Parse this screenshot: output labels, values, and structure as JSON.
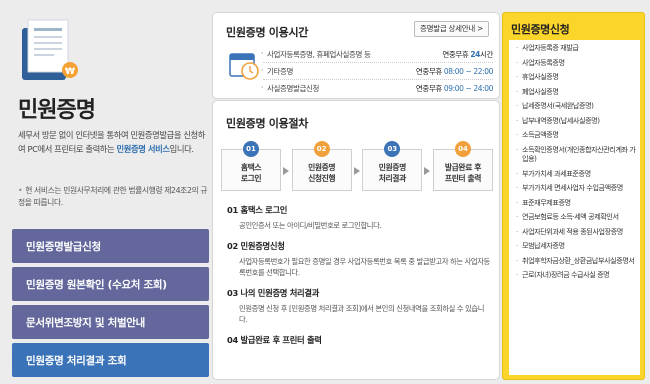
{
  "left": {
    "title": "민원증명",
    "desc_part1": "세무서 방문 없이 인터넷을 통하여 민원증명발급을 신청하여 PC에서 프린터로 출력하는 ",
    "desc_highlight": "민원증명 서비스",
    "desc_part2": "입니다.",
    "note": "현 서비스는 민원사무처리에 관한 법률시행령 제24조2의 규정을 따릅니다.",
    "menu": [
      "민원증명발급신청",
      "민원증명 원본확인 (수요처 조회)",
      "문서위변조방지 및 처벌안내",
      "민원증명 처리결과 조회"
    ]
  },
  "hours": {
    "title": "민원증명 이용시간",
    "detail_button": "증명발급 상세안내 >",
    "rows": [
      {
        "label": "사업자등록증명, 휴폐업사실증명 등",
        "val_prefix": "연중무휴 ",
        "val_time": "24",
        "val_suffix": "시간"
      },
      {
        "label": "기타증명",
        "val_prefix": "연중무휴 ",
        "val_time": "08:00 ~ 22:00",
        "val_suffix": ""
      },
      {
        "label": "사실증명발급신청",
        "val_prefix": "연중무휴 ",
        "val_time": "09:00 ~ 24:00",
        "val_suffix": ""
      }
    ]
  },
  "procedure": {
    "title": "민원증명 이용절차",
    "steps": [
      {
        "num": "01",
        "label": "홈택스\n로그인",
        "color": "#3b73b8"
      },
      {
        "num": "02",
        "label": "민원증명\n신청진행",
        "color": "#f0a13c"
      },
      {
        "num": "03",
        "label": "민원증명\n처리결과",
        "color": "#3b73b8"
      },
      {
        "num": "04",
        "label": "발급완료 후\n프린터 출력",
        "color": "#f0a13c"
      }
    ],
    "items": [
      {
        "head": "01 홈택스 로그인",
        "body": "공인인증서 또는 아이디/비밀번호로 로그인합니다."
      },
      {
        "head": "02 민원증명신청",
        "body": "사업자등록번호가 필요한 증명일 경우 사업자등록번호 목록 중 발급받고자 하는 사업자등록번호를 선택합니다."
      },
      {
        "head": "03 나의 민원증명 처리결과",
        "body": "민원증명 신청 후 [민원증명 처리결과 조회]에서 본인의 신청내역을 조회하실 수 있습니다."
      },
      {
        "head": "04 발급완료 후 프린터 출력",
        "body": ""
      }
    ]
  },
  "application": {
    "title": "민원증명신청",
    "items": [
      "사업자등록증 재발급",
      "사업자등록증명",
      "휴업사실증명",
      "폐업사실증명",
      "납세증명서(국세완납증명)",
      "납부내역증명(납세사실증명)",
      "소득금액증명",
      "소득확인증명서(개인종합자산관리계좌 가입용)",
      "부가가치세 과세표준증명",
      "부가가치세 면세사업자 수입금액증명",
      "표준재무제표증명",
      "연금보험료등 소득·세액 공제확인서",
      "사업자단위과세 적용 종된사업장증명",
      "모범납세자증명",
      "취업후학자금상환_상환금납부사실증명서",
      "근로(자녀)장려금 수급사실 증명"
    ]
  }
}
